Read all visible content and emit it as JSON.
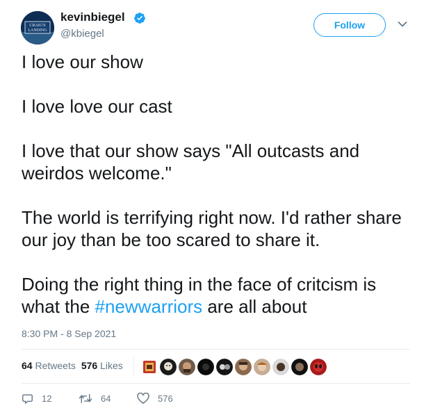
{
  "author": {
    "display_name": "kevinbiegel",
    "handle": "@kbiegel",
    "avatar_text_line1": "CRAIG'S",
    "avatar_text_line2": "LANDING",
    "verified_icon": "verified-badge-icon"
  },
  "header": {
    "follow_label": "Follow",
    "menu_icon": "chevron-down-icon"
  },
  "tweet": {
    "paragraphs": [
      "I love our show",
      "I love love our cast",
      "I love that our show says \"All outcasts and weirdos welcome.\"",
      "The world is terrifying right now. I'd rather share our joy than be too scared to share it."
    ],
    "last_paragraph_before": "Doing the right thing in the face of critcism is what the ",
    "hashtag": "#newwarriors",
    "last_paragraph_after": " are all about",
    "timestamp": "8:30 PM - 8 Sep 2021"
  },
  "stats": {
    "retweets_count": "64",
    "retweets_label": "Retweets",
    "likes_count": "576",
    "likes_label": "Likes",
    "liker_avatar_count": 10
  },
  "actions": {
    "reply_count": "12",
    "retweet_count": "64",
    "like_count": "576",
    "reply_icon": "reply-icon",
    "retweet_icon": "retweet-icon",
    "like_icon": "heart-icon"
  },
  "colors": {
    "accent": "#1da1f2",
    "text": "#14171a",
    "secondary": "#657786",
    "divider": "#e6ecf0"
  }
}
